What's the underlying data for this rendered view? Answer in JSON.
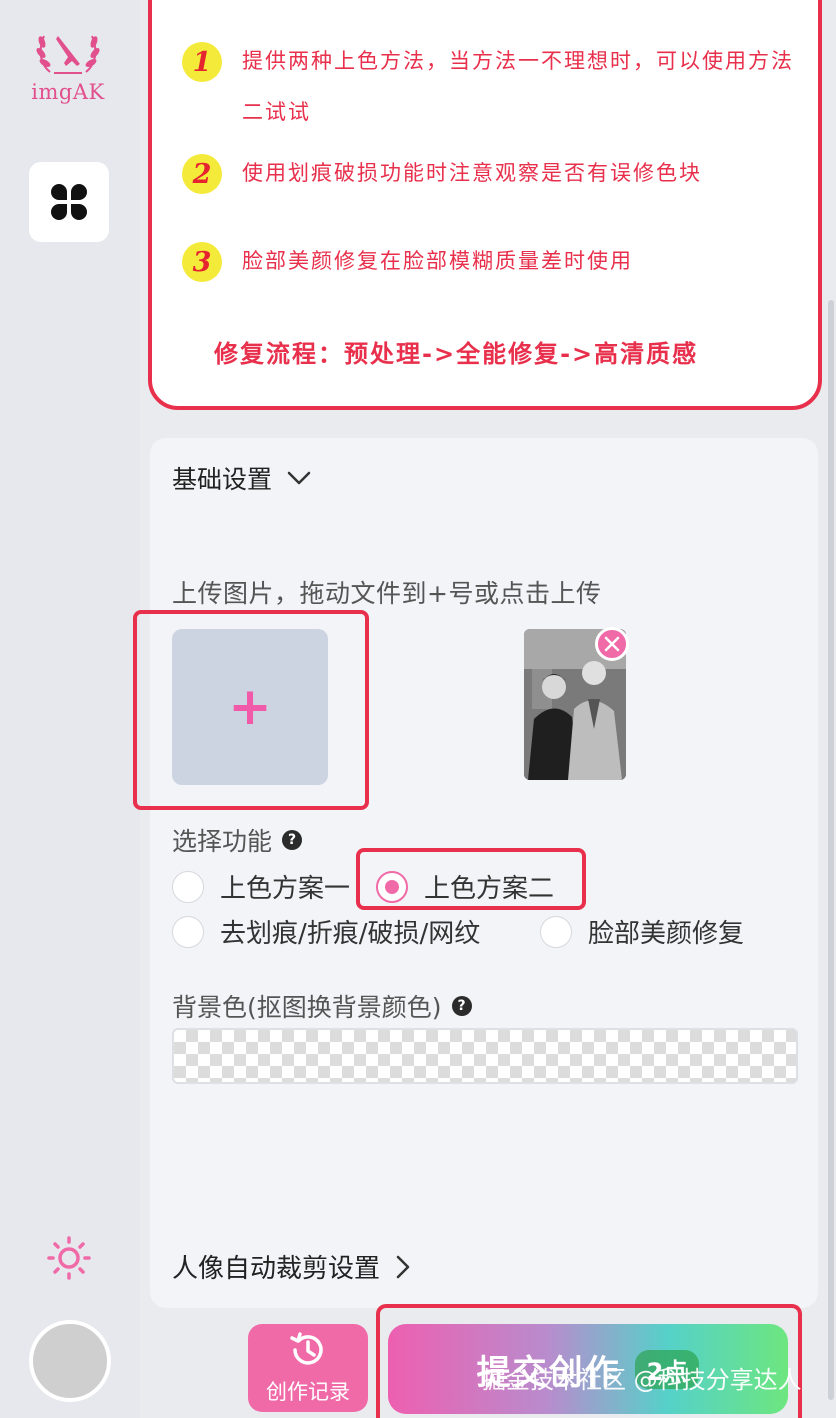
{
  "brand": {
    "name": "imgAK"
  },
  "colors": {
    "accent": "#f06aa8",
    "highlight": "#e8304c",
    "notice_text": "#e8304c"
  },
  "sidebar": {
    "apps_icon": "grid-four-petal-icon",
    "theme_icon": "sun-icon"
  },
  "notice": {
    "items": [
      {
        "num": "1",
        "text": "提供两种上色方法，当方法一不理想时，可以使用方法二试试"
      },
      {
        "num": "2",
        "text": "使用划痕破损功能时注意观察是否有误修色块"
      },
      {
        "num": "3",
        "text": "脸部美颜修复在脸部模糊质量差时使用"
      }
    ],
    "flow": "修复流程：预处理->全能修复->高清质感"
  },
  "settings": {
    "basic_title": "基础设置",
    "upload_label": "上传图片，拖动文件到+号或点击上传",
    "upload_plus": "+",
    "function_label": "选择功能",
    "help_glyph": "?",
    "options": [
      {
        "label": "上色方案一",
        "selected": false
      },
      {
        "label": "上色方案二",
        "selected": true
      },
      {
        "label": "去划痕/折痕/破损/网纹",
        "selected": false
      },
      {
        "label": "脸部美颜修复",
        "selected": false
      }
    ],
    "bg_label": "背景色(抠图换背景颜色)",
    "crop_title": "人像自动裁剪设置"
  },
  "actions": {
    "history_label": "创作记录",
    "submit_label": "提交创作",
    "cost": "2点"
  },
  "watermark": "掘金技术社区 @科技分享达人"
}
